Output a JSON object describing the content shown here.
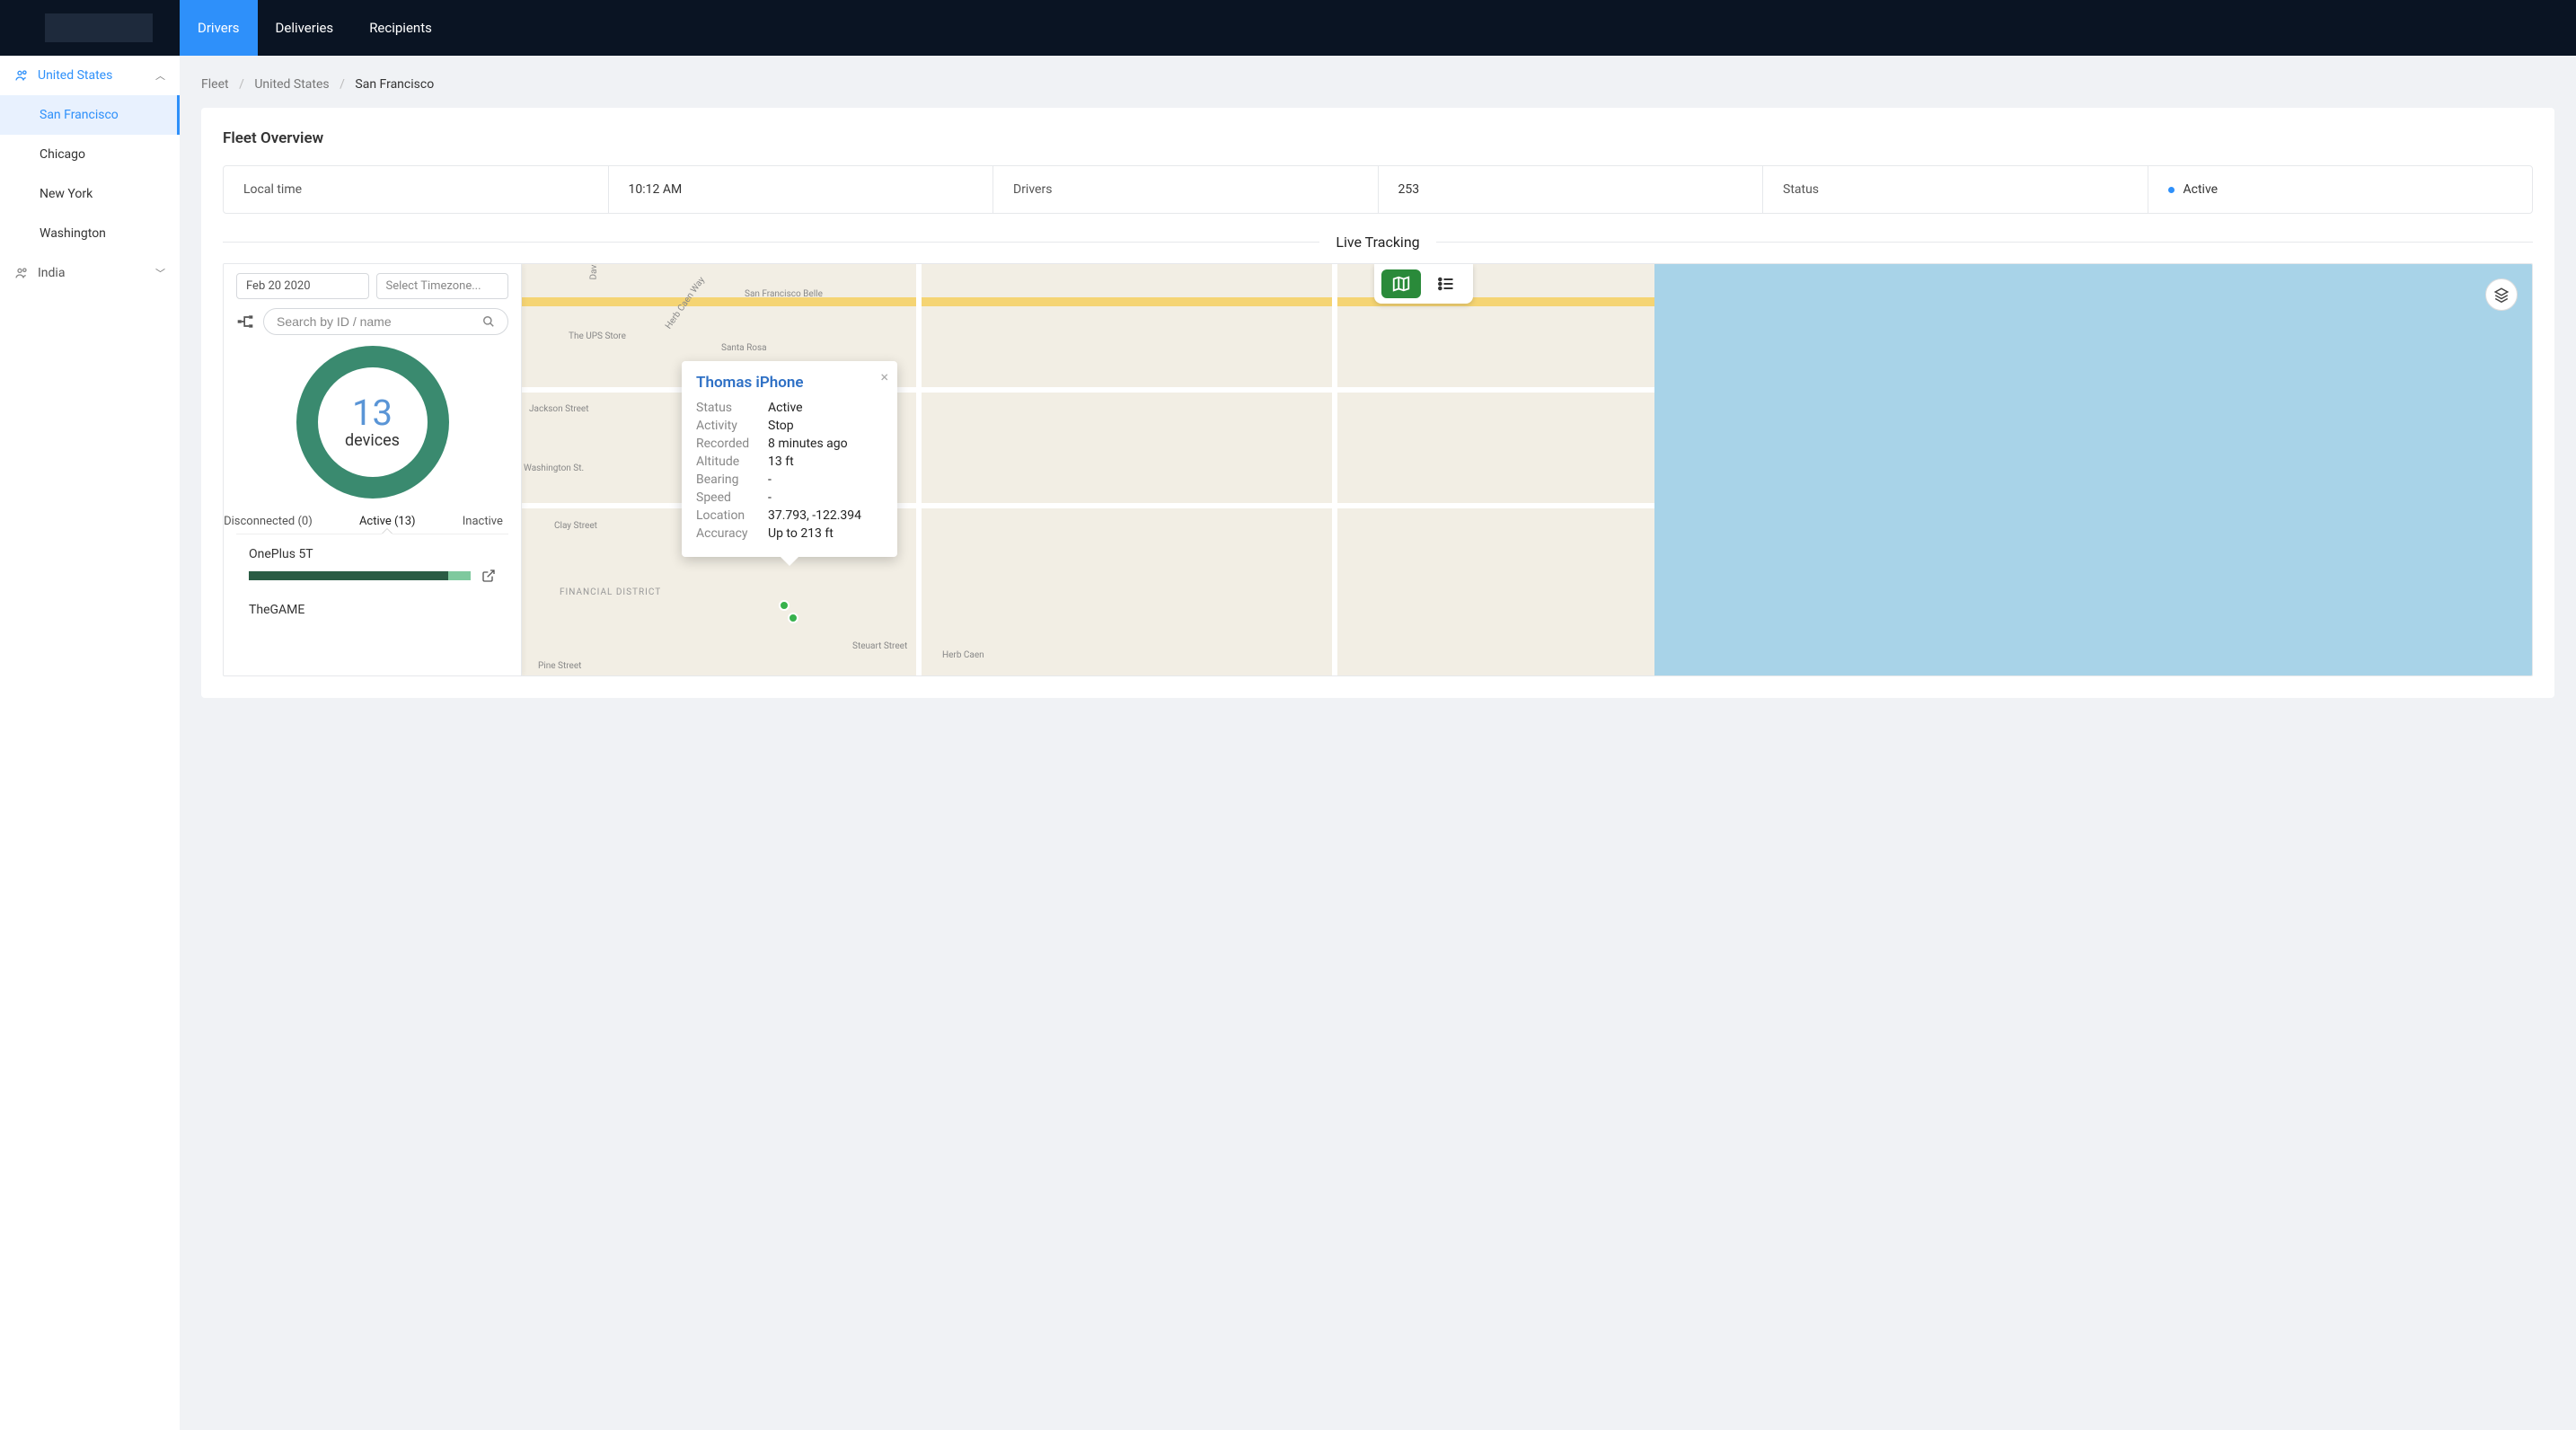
{
  "nav": {
    "tabs": [
      "Drivers",
      "Deliveries",
      "Recipients"
    ],
    "active": 0
  },
  "sidebar": {
    "groups": [
      {
        "name": "United States",
        "expanded": true,
        "items": [
          "San Francisco",
          "Chicago",
          "New York",
          "Washington"
        ],
        "selected": 0
      },
      {
        "name": "India",
        "expanded": false,
        "items": []
      }
    ]
  },
  "breadcrumb": {
    "parts": [
      "Fleet",
      "United States",
      "San Francisco"
    ]
  },
  "page": {
    "title": "Fleet Overview"
  },
  "stats": {
    "local_time_label": "Local time",
    "local_time_value": "10:12 AM",
    "drivers_label": "Drivers",
    "drivers_value": "253",
    "status_label": "Status",
    "status_value": "Active"
  },
  "tracking": {
    "title": "Live Tracking",
    "date_value": "Feb 20 2020",
    "timezone_placeholder": "Select Timezone...",
    "search_placeholder": "Search by ID / name",
    "donut_count": "13",
    "donut_label": "devices",
    "status_tabs": {
      "disconnected": "Disconnected (0)",
      "active": "Active (13)",
      "inactive": "Inactive"
    },
    "devices": [
      {
        "name": "OnePlus 5T"
      },
      {
        "name": "TheGAME"
      }
    ]
  },
  "popup": {
    "title": "Thomas iPhone",
    "rows": [
      {
        "k": "Status",
        "v": "Active"
      },
      {
        "k": "Activity",
        "v": "Stop"
      },
      {
        "k": "Recorded",
        "v": "8 minutes ago"
      },
      {
        "k": "Altitude",
        "v": "13 ft"
      },
      {
        "k": "Bearing",
        "v": "-"
      },
      {
        "k": "Speed",
        "v": "-"
      },
      {
        "k": "Location",
        "v": "37.793, -122.394"
      },
      {
        "k": "Accuracy",
        "v": "Up to 213 ft"
      }
    ]
  },
  "map_labels": {
    "jackson": "Jackson Street",
    "washington": "Washington St.",
    "clay": "Clay Street",
    "pine": "Pine Street",
    "davis": "Davis Street",
    "financial": "FINANCIAL DISTRICT",
    "ups": "The UPS Store",
    "santa_rosa": "Santa Rosa",
    "sf_belle": "San Francisco Belle",
    "herb": "Herb Caen Way",
    "steuart": "Steuart Street",
    "herb_caen": "Herb Caen"
  }
}
